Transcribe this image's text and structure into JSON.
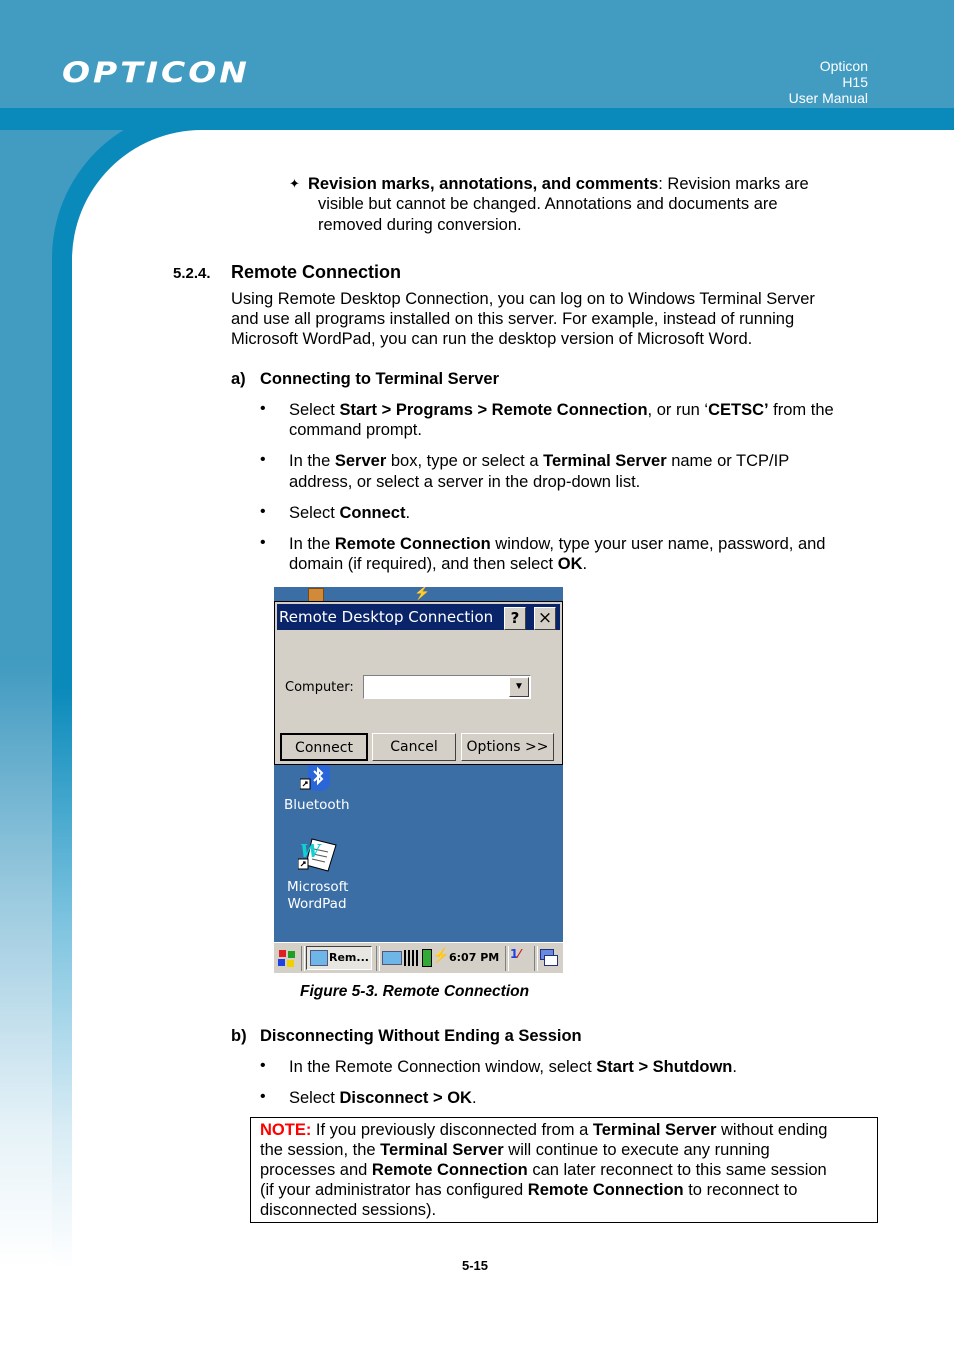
{
  "header": {
    "logo": "OPTICON",
    "right_lines": [
      "Opticon",
      "H15",
      "User Manual"
    ],
    "colors": {
      "header_bg": "#429bc1",
      "band": "#0a8abb"
    }
  },
  "intro_item": {
    "bullet": "✦",
    "bold": "Revision marks, annotations, and comments",
    "rest_line1": ": Revision marks are",
    "line2": "visible but cannot be changed. Annotations and documents are",
    "line3": "removed during conversion."
  },
  "section": {
    "number": "5.2.4.",
    "title": "Remote Connection",
    "para_lines": [
      "Using Remote Desktop Connection, you can log on to Windows Terminal Server",
      "and use all programs installed on this server. For example, instead of running",
      "Microsoft WordPad, you can run the desktop version of Microsoft Word."
    ]
  },
  "subsection_a": {
    "label": "a)",
    "title": "Connecting to Terminal Server",
    "bullets": [
      {
        "parts": [
          [
            "Select ",
            false
          ],
          [
            "Start > Programs > Remote Connection",
            true
          ],
          [
            ", or run ‘",
            false
          ],
          [
            "CETSC’",
            true
          ],
          [
            " from the",
            false
          ]
        ],
        "line2": "command prompt."
      },
      {
        "parts": [
          [
            "In the ",
            false
          ],
          [
            "Server",
            true
          ],
          [
            " box, type or select a ",
            false
          ],
          [
            "Terminal Server",
            true
          ],
          [
            " name or TCP/IP",
            false
          ]
        ],
        "line2": "address, or select a server in the drop-down list."
      },
      {
        "parts": [
          [
            "Select ",
            false
          ],
          [
            "Connect",
            true
          ],
          [
            ".",
            false
          ]
        ],
        "line2": ""
      },
      {
        "parts": [
          [
            "In the ",
            false
          ],
          [
            "Remote Connection",
            true
          ],
          [
            " window, type your user name, password, and",
            false
          ]
        ],
        "line2_parts": [
          [
            "domain (if required), and then select ",
            false
          ],
          [
            "OK",
            true
          ],
          [
            ".",
            false
          ]
        ]
      }
    ]
  },
  "figure": {
    "dialog_title": "Remote Desktop Connection",
    "help_button": "?",
    "close_button": "×",
    "computer_label": "Computer:",
    "computer_value": "",
    "buttons": {
      "connect": "Connect",
      "cancel": "Cancel",
      "options": "Options >>"
    },
    "desktop_icons": [
      {
        "label": "Bluetooth",
        "icon": "bluetooth-icon"
      },
      {
        "label": "Microsoft WordPad",
        "icon": "wordpad-icon"
      }
    ],
    "taskbar": {
      "task_label": "Rem...",
      "time": "6:07 PM"
    },
    "caption": "Figure 5-3. Remote Connection"
  },
  "subsection_b": {
    "label": "b)",
    "title": "Disconnecting Without Ending a Session",
    "bullets": [
      {
        "parts": [
          [
            "In the Remote Connection window, select ",
            false
          ],
          [
            "Start > Shutdown",
            true
          ],
          [
            ".",
            false
          ]
        ]
      },
      {
        "parts": [
          [
            "Select ",
            false
          ],
          [
            "Disconnect > OK",
            true
          ],
          [
            ".",
            false
          ]
        ]
      }
    ]
  },
  "note": {
    "label": "NOTE:",
    "lines": [
      [
        [
          " If you previously disconnected from a ",
          false
        ],
        [
          "Terminal Server",
          true
        ],
        [
          " without ending",
          false
        ]
      ],
      [
        [
          "the session, the ",
          false
        ],
        [
          "Terminal Server",
          true
        ],
        [
          " will continue to execute any running",
          false
        ]
      ],
      [
        [
          "processes and ",
          false
        ],
        [
          "Remote Connection",
          true
        ],
        [
          " can later reconnect to this same session",
          false
        ]
      ],
      [
        [
          "(if your administrator has configured ",
          false
        ],
        [
          "Remote Connection",
          true
        ],
        [
          " to reconnect to",
          false
        ]
      ],
      [
        [
          "disconnected sessions).",
          false
        ]
      ]
    ]
  },
  "page_number": "5-15"
}
